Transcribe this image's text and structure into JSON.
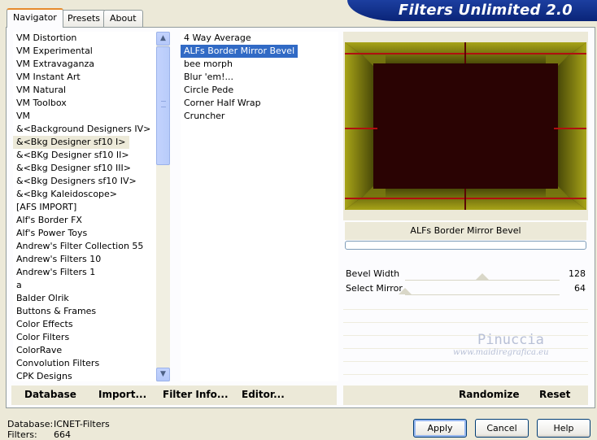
{
  "title": "Filters Unlimited 2.0",
  "tabs": [
    {
      "label": "Navigator",
      "active": true
    },
    {
      "label": "Presets",
      "active": false
    },
    {
      "label": "About",
      "active": false
    }
  ],
  "categories": [
    "VM Distortion",
    "VM Experimental",
    "VM Extravaganza",
    "VM Instant Art",
    "VM Natural",
    "VM Toolbox",
    "VM",
    "&<Background Designers IV>",
    "&<Bkg Designer sf10 I>",
    "&<BKg Designer sf10 II>",
    "&<Bkg Designer sf10 III>",
    "&<Bkg Designers sf10 IV>",
    "&<Bkg Kaleidoscope>",
    "[AFS IMPORT]",
    "Alf's Border FX",
    "Alf's Power Toys",
    "Andrew's Filter Collection 55",
    "Andrew's Filters 10",
    "Andrew's Filters 1",
    "a",
    "Balder Olrik",
    "Buttons & Frames",
    "Color Effects",
    "Color Filters",
    "ColorRave",
    "Convolution Filters",
    "CPK Designs"
  ],
  "selected_category": "&<Bkg Designer sf10 I>",
  "filters": [
    "4 Way Average",
    "ALFs Border Mirror Bevel",
    "bee morph",
    "Blur 'em!...",
    "Circle Pede",
    "Corner Half Wrap",
    "Cruncher"
  ],
  "selected_filter": "ALFs Border Mirror Bevel",
  "current_filter_label": "ALFs Border Mirror Bevel",
  "params": [
    {
      "name": "Bevel Width",
      "value": "128",
      "level": 128,
      "max": 255
    },
    {
      "name": "Select Mirror",
      "value": "64",
      "level": 0,
      "max": 255
    }
  ],
  "watermark": {
    "line1": "Pinuccia",
    "line2": "www.maidiregrafica.eu"
  },
  "commands": {
    "database": "Database",
    "import": "Import...",
    "filter_info": "Filter Info...",
    "editor": "Editor...",
    "randomize": "Randomize",
    "reset": "Reset"
  },
  "status": {
    "database_label": "Database:",
    "database_value": "ICNET-Filters",
    "filters_label": "Filters:",
    "filters_value": "664"
  },
  "buttons": {
    "apply": "Apply",
    "cancel": "Cancel",
    "help": "Help"
  },
  "colors": {
    "selection": "#316ac5",
    "banner": "#0a2478",
    "preview_bg": "#2a0303",
    "preview_frame": "#8a8a14"
  },
  "icons": {
    "scroll_up": "chevron-up-icon",
    "scroll_down": "chevron-down-icon"
  }
}
